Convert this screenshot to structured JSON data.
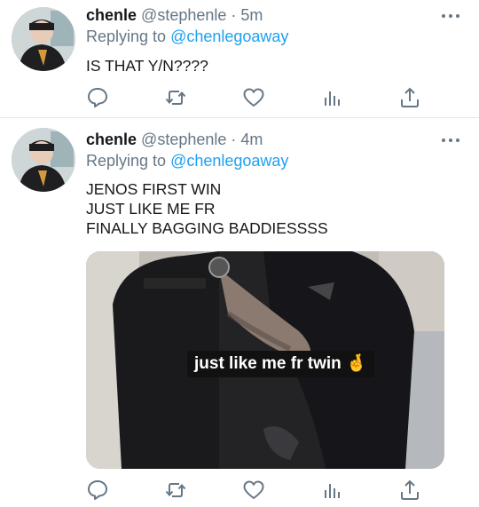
{
  "tweets": [
    {
      "author_name": "chenle",
      "author_handle": "@stephenle",
      "separator": "·",
      "time": "5m",
      "replying_prefix": "Replying to",
      "replying_to": "@chenlegoaway",
      "text": "IS THAT Y/N????"
    },
    {
      "author_name": "chenle",
      "author_handle": "@stephenle",
      "separator": "·",
      "time": "4m",
      "replying_prefix": "Replying to",
      "replying_to": "@chenlegoaway",
      "text": "JENOS FIRST WIN\nJUST LIKE ME FR\nFINALLY BAGGING BADDIESSSS",
      "media_caption": "just like me fr twin 🤞"
    }
  ],
  "icons": {
    "reply": "reply-icon",
    "retweet": "retweet-icon",
    "like": "heart-icon",
    "analytics": "analytics-icon",
    "share": "share-icon",
    "more": "more-icon"
  },
  "colors": {
    "link": "#1da1f2",
    "secondary_text": "#657786",
    "icon": "#657786",
    "divider": "#e1e8ed"
  }
}
